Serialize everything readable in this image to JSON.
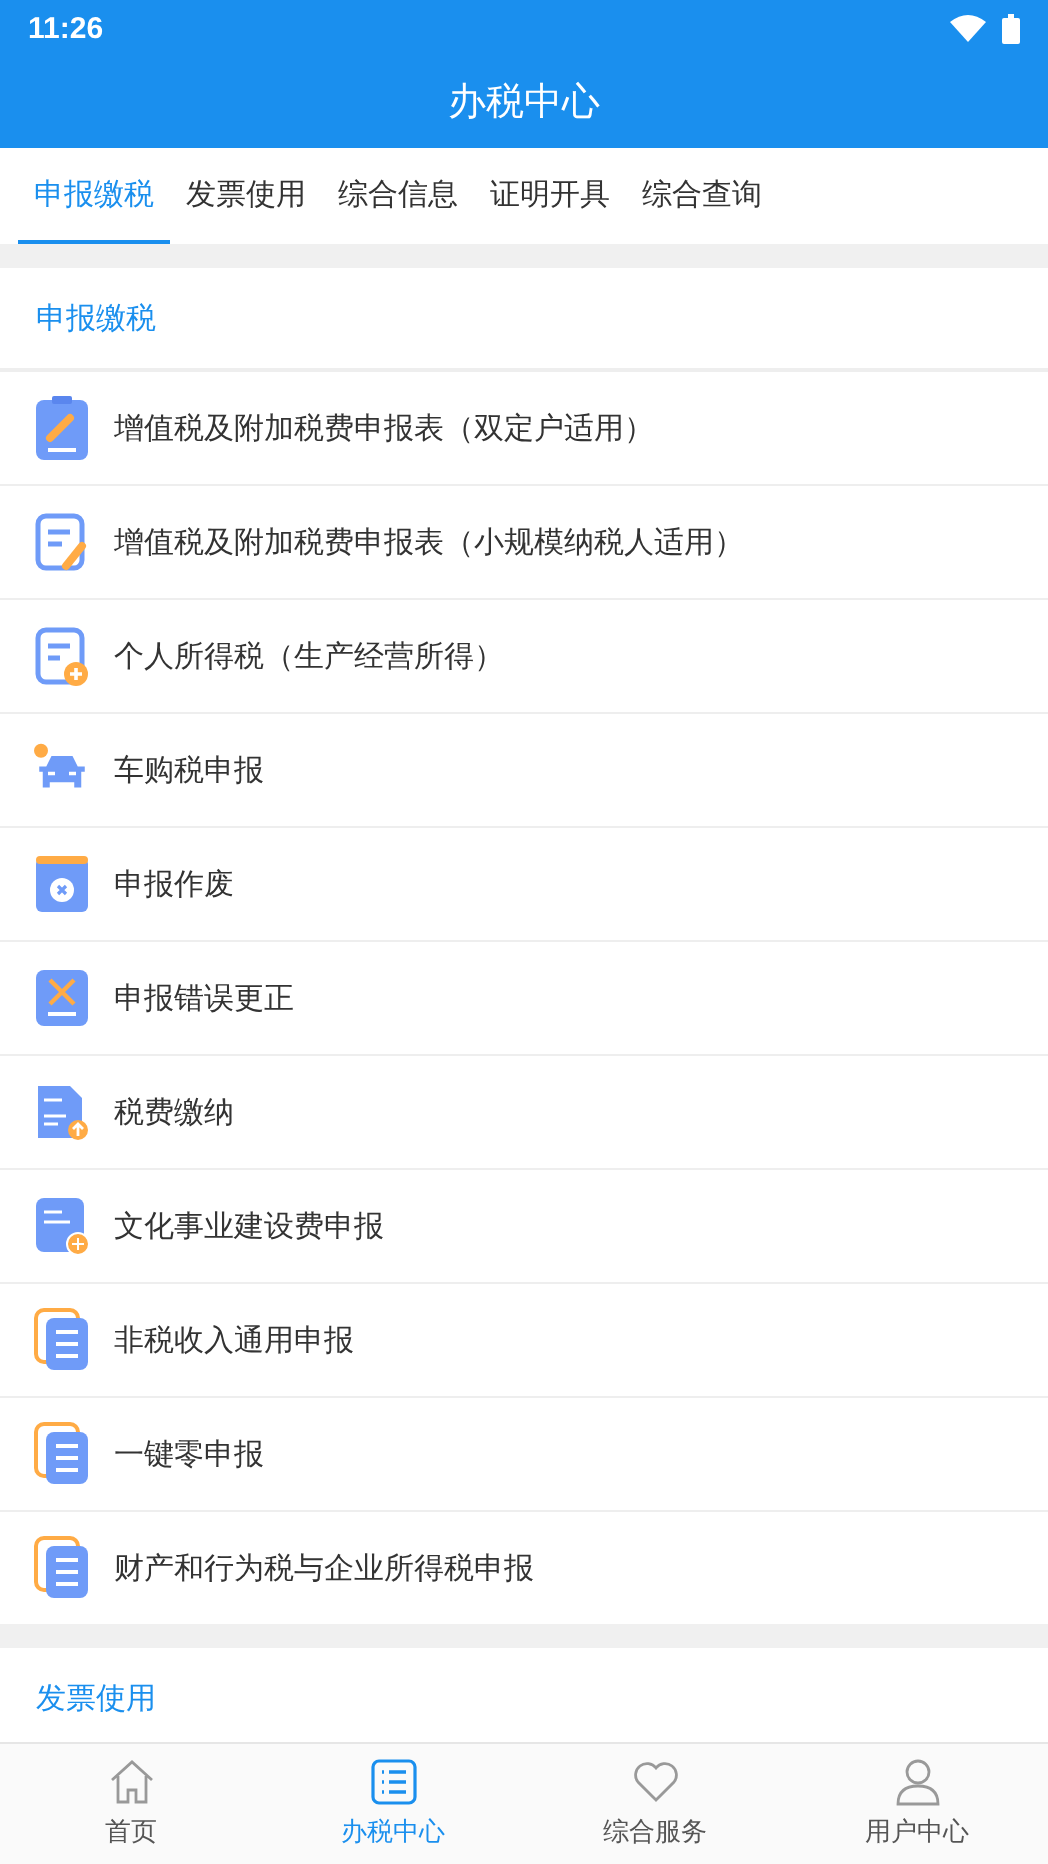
{
  "status_bar": {
    "time": "11:26"
  },
  "header": {
    "title": "办税中心"
  },
  "tabs": [
    {
      "label": "申报缴税",
      "selected": true
    },
    {
      "label": "发票使用",
      "selected": false
    },
    {
      "label": "综合信息",
      "selected": false
    },
    {
      "label": "证明开具",
      "selected": false
    },
    {
      "label": "综合查询",
      "selected": false
    }
  ],
  "sections": [
    {
      "title": "申报缴税",
      "items": [
        {
          "label": "增值税及附加税费申报表（双定户适用）",
          "kind": "clipboard"
        },
        {
          "label": "增值税及附加税费申报表（小规模纳税人适用）",
          "kind": "form-pen"
        },
        {
          "label": "个人所得税（生产经营所得）",
          "kind": "form-plus"
        },
        {
          "label": "车购税申报",
          "kind": "car"
        },
        {
          "label": "申报作废",
          "kind": "window-x"
        },
        {
          "label": "申报错误更正",
          "kind": "box-x"
        },
        {
          "label": "税费缴纳",
          "kind": "tax-doc"
        },
        {
          "label": "文化事业建设费申报",
          "kind": "doc-globe"
        },
        {
          "label": "非税收入通用申报",
          "kind": "stack"
        },
        {
          "label": "一键零申报",
          "kind": "stack"
        },
        {
          "label": "财产和行为税与企业所得税申报",
          "kind": "stack"
        }
      ]
    },
    {
      "title": "发票使用"
    }
  ],
  "bottom_nav": [
    {
      "label": "首页",
      "kind": "home",
      "selected": false
    },
    {
      "label": "办税中心",
      "kind": "list",
      "selected": true
    },
    {
      "label": "综合服务",
      "kind": "heart",
      "selected": false
    },
    {
      "label": "用户中心",
      "kind": "user",
      "selected": false
    }
  ]
}
